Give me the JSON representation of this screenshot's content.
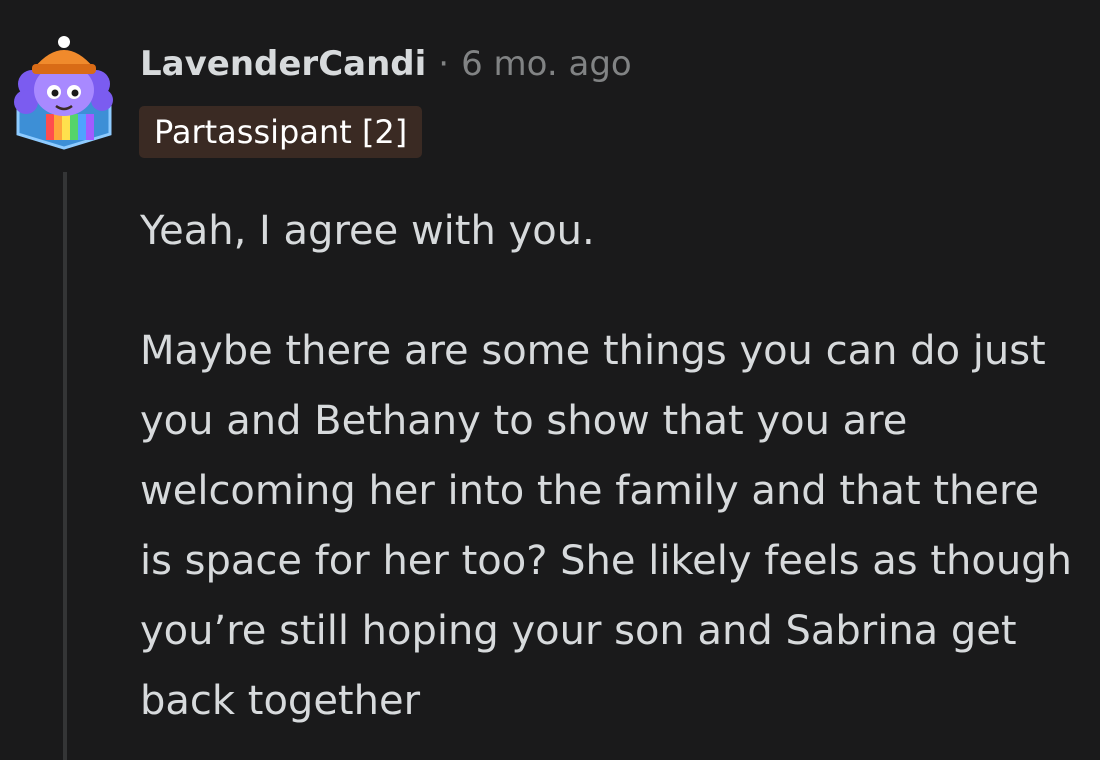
{
  "comment": {
    "author": "LavenderCandi",
    "separator": "·",
    "timestamp": "6 mo. ago",
    "flair": "Partassipant [2]",
    "avatar_icon": "snoo-avatar-icon",
    "paragraphs": [
      "Yeah, I agree with you.",
      "Maybe there are some things you can do just you and Bethany to show that you are welcoming her into the family and that there is space for her too? She likely feels as though you’re still hoping your son and Sabrina get back together"
    ]
  },
  "colors": {
    "background": "#1a1a1b",
    "text": "#d7dadc",
    "meta": "#818384",
    "flair_bg": "#3a2a23",
    "thread_line": "#343536",
    "avatar_purple": "#7b5cf0"
  }
}
